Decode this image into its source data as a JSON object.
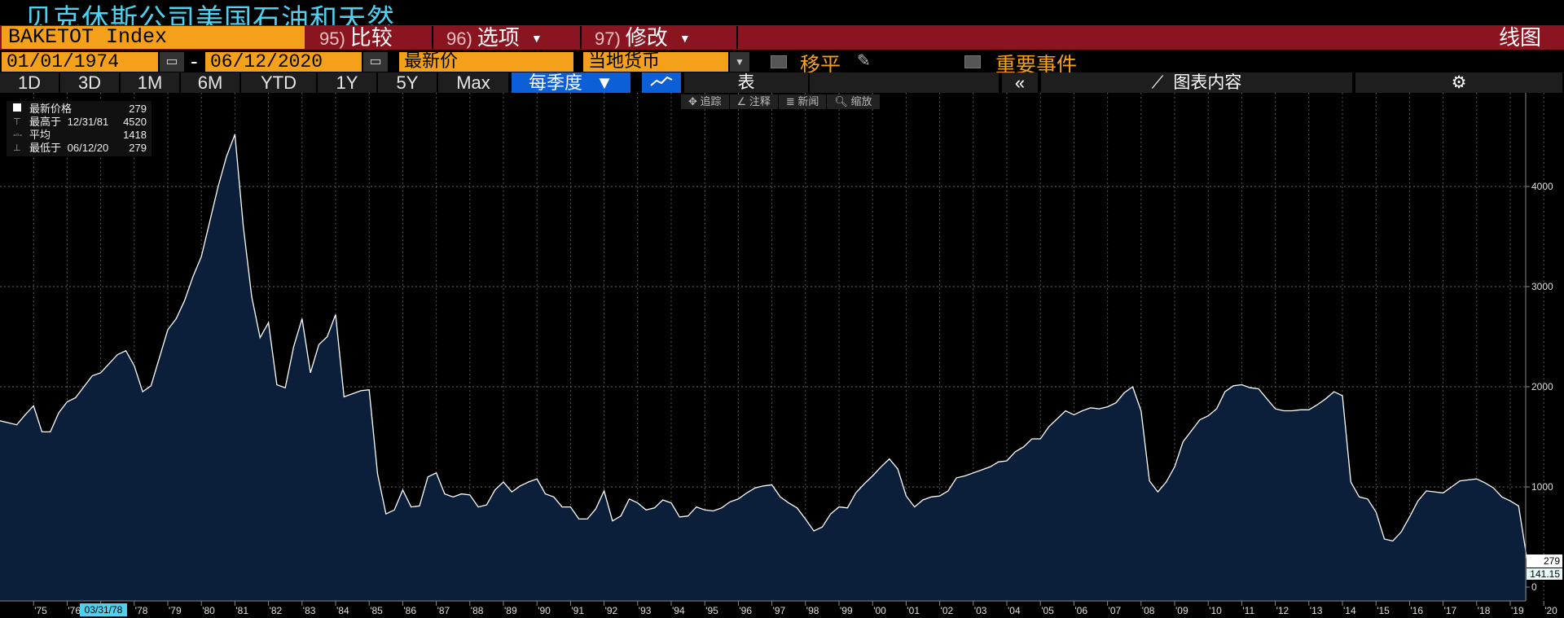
{
  "window_title": "贝克休斯公司美国石油和天然...",
  "command_bar": {
    "ticker": "BAKETOT Index",
    "compare_num": "95)",
    "compare_label": "比较",
    "options_num": "96)",
    "options_label": "选项",
    "modify_num": "97)",
    "modify_label": "修改",
    "view_label": "线图"
  },
  "date_row": {
    "start_date": "01/01/1974",
    "separator": "-",
    "end_date": "06/12/2020",
    "price_field": "最新价",
    "currency_field": "当地货币",
    "moving_avg_label": "移平",
    "events_label": "重要事件"
  },
  "timeframes": [
    "1D",
    "3D",
    "1M",
    "6M",
    "YTD",
    "1Y",
    "5Y",
    "Max"
  ],
  "period_select": "每季度",
  "table_button": "表",
  "chart_content_button": "图表内容",
  "annotation_tools": [
    "追踪",
    "注释",
    "新闻",
    "缩放"
  ],
  "legend": {
    "rows": [
      {
        "label": "最新价格",
        "date": "",
        "value": "279"
      },
      {
        "label": "最高于",
        "date": "12/31/81",
        "value": "4520"
      },
      {
        "label": "平均",
        "date": "",
        "value": "1418"
      },
      {
        "label": "最低于",
        "date": "06/12/20",
        "value": "279"
      }
    ]
  },
  "last_value_label": "279",
  "secondary_value_label": "141.15",
  "cursor_date_label": "03/31/78",
  "colors": {
    "line": "#ffffff",
    "fill": "#0b1f3a",
    "accent_orange": "#f5a01a",
    "bar_red": "#8b1421",
    "title_cyan": "#4fd0ef"
  },
  "chart_data": {
    "type": "area",
    "frequency": "quarterly",
    "x_start": "1974-01",
    "x_ticks": [
      "'75",
      "'76",
      "'77",
      "'78",
      "'79",
      "'80",
      "'81",
      "'82",
      "'83",
      "'84",
      "'85",
      "'86",
      "'87",
      "'88",
      "'89",
      "'90",
      "'91",
      "'92",
      "'93",
      "'94",
      "'95",
      "'96",
      "'97",
      "'98",
      "'99",
      "'00",
      "'01",
      "'02",
      "'03",
      "'04",
      "'05",
      "'06",
      "'07",
      "'08",
      "'09",
      "'10",
      "'11",
      "'12",
      "'13",
      "'14",
      "'15",
      "'16",
      "'17",
      "'18",
      "'19",
      "'20"
    ],
    "y_ticks": [
      0,
      1000,
      2000,
      3000,
      4000
    ],
    "ylim": [
      -100,
      4900
    ],
    "grid": true,
    "values": [
      1660,
      1620,
      1720,
      1810,
      1550,
      1550,
      1740,
      1850,
      1890,
      2000,
      2110,
      2140,
      2230,
      2320,
      2360,
      2210,
      1950,
      2010,
      2290,
      2570,
      2680,
      2860,
      3100,
      3300,
      3650,
      4000,
      4300,
      4520,
      3600,
      2900,
      2490,
      2640,
      2020,
      1990,
      2400,
      2680,
      2140,
      2420,
      2500,
      2720,
      1900,
      1930,
      1960,
      1970,
      1130,
      730,
      770,
      970,
      800,
      810,
      1100,
      1140,
      930,
      900,
      930,
      920,
      800,
      820,
      970,
      1050,
      950,
      1010,
      1050,
      1080,
      930,
      900,
      800,
      800,
      680,
      680,
      780,
      960,
      660,
      710,
      880,
      840,
      770,
      790,
      870,
      840,
      700,
      710,
      800,
      770,
      760,
      790,
      850,
      880,
      940,
      990,
      1010,
      1020,
      900,
      840,
      790,
      680,
      560,
      600,
      730,
      800,
      790,
      940,
      1030,
      1110,
      1200,
      1280,
      1180,
      910,
      800,
      870,
      900,
      910,
      960,
      1090,
      1110,
      1140,
      1170,
      1200,
      1250,
      1260,
      1350,
      1400,
      1480,
      1480,
      1600,
      1680,
      1760,
      1720,
      1760,
      1790,
      1780,
      1800,
      1840,
      1940,
      2000,
      1760,
      1060,
      950,
      1050,
      1200,
      1450,
      1560,
      1670,
      1710,
      1780,
      1950,
      2010,
      2020,
      1990,
      1980,
      1880,
      1780,
      1760,
      1760,
      1770,
      1770,
      1820,
      1880,
      1950,
      1910,
      1050,
      900,
      880,
      750,
      480,
      460,
      550,
      700,
      860,
      960,
      950,
      940,
      1000,
      1060,
      1070,
      1080,
      1040,
      990,
      900,
      860,
      810,
      279
    ]
  }
}
